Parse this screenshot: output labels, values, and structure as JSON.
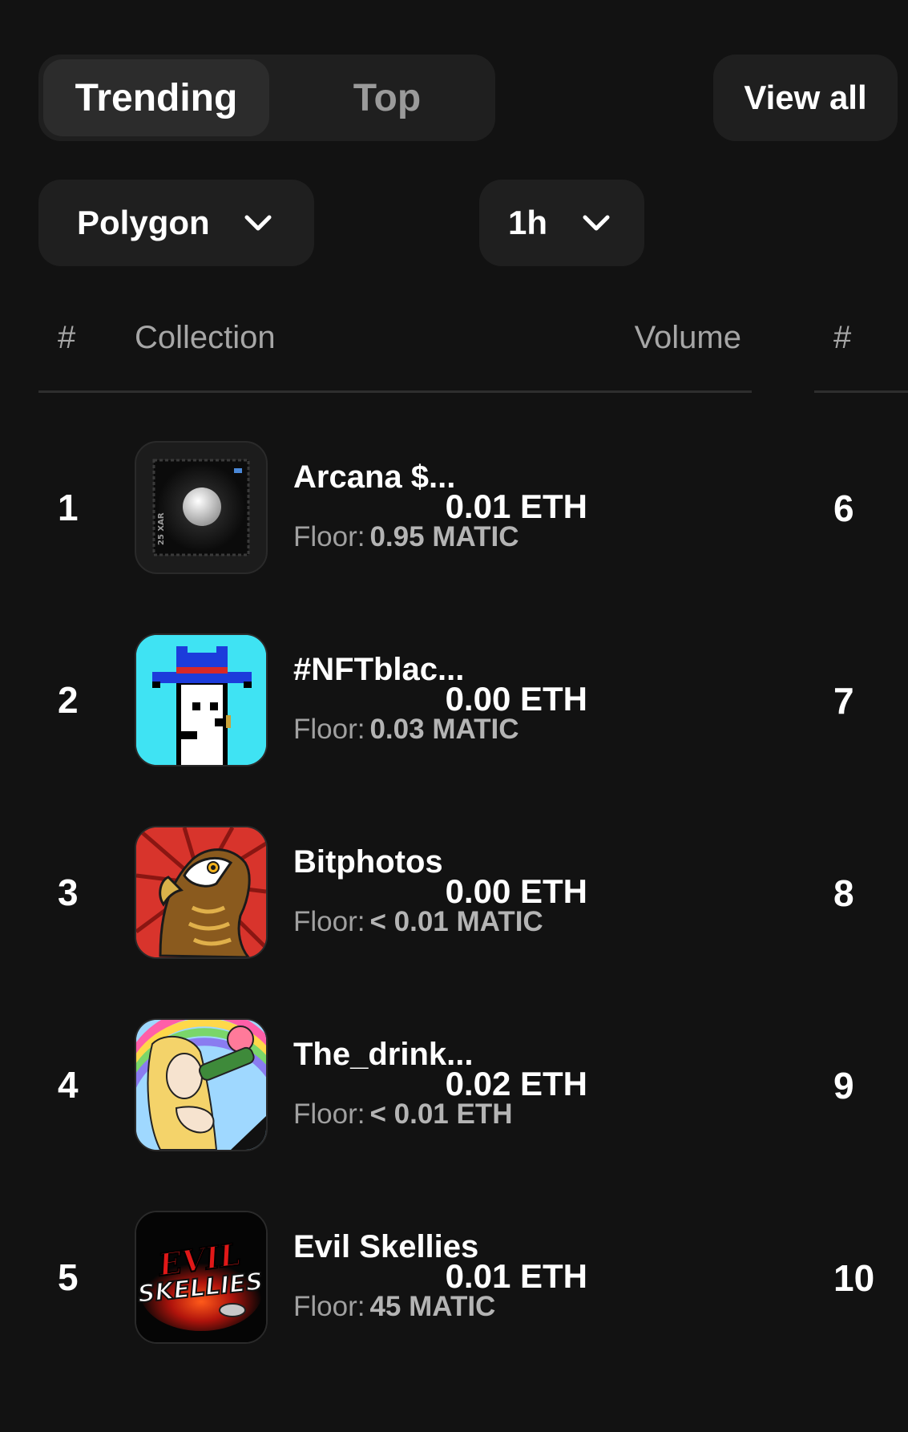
{
  "tabs": {
    "trending": "Trending",
    "top": "Top"
  },
  "view_all": "View all",
  "filters": {
    "chain": "Polygon",
    "period": "1h"
  },
  "table": {
    "col_rank": "#",
    "col_collection": "Collection",
    "col_volume": "Volume",
    "col_rank2": "#"
  },
  "rows": [
    {
      "rank": "1",
      "name": "Arcana $...",
      "floor_label": "Floor:",
      "floor_value": "0.95 MATIC",
      "volume": "0.01 ETH",
      "rank2": "6",
      "icon": "arcana-stamp-icon"
    },
    {
      "rank": "2",
      "name": "#NFTblac...",
      "floor_label": "Floor:",
      "floor_value": "0.03 MATIC",
      "volume": "0.00 ETH",
      "rank2": "7",
      "icon": "punk-cowboy-icon"
    },
    {
      "rank": "3",
      "name": "Bitphotos",
      "floor_label": "Floor:",
      "floor_value": "< 0.01 MATIC",
      "volume": "0.00 ETH",
      "rank2": "8",
      "icon": "eagle-icon"
    },
    {
      "rank": "4",
      "name": "The_drink...",
      "floor_label": "Floor:",
      "floor_value": "< 0.01 ETH",
      "volume": "0.02 ETH",
      "rank2": "9",
      "icon": "drinking-woman-icon"
    },
    {
      "rank": "5",
      "name": "Evil Skellies",
      "floor_label": "Floor:",
      "floor_value": "45 MATIC",
      "volume": "0.01 ETH",
      "rank2": "10",
      "icon": "evil-skellies-logo-icon"
    }
  ],
  "thumb_text": {
    "stamp_side": "25 XAR",
    "skellies_top": "EVIL",
    "skellies_bottom": "SKELLIES"
  }
}
